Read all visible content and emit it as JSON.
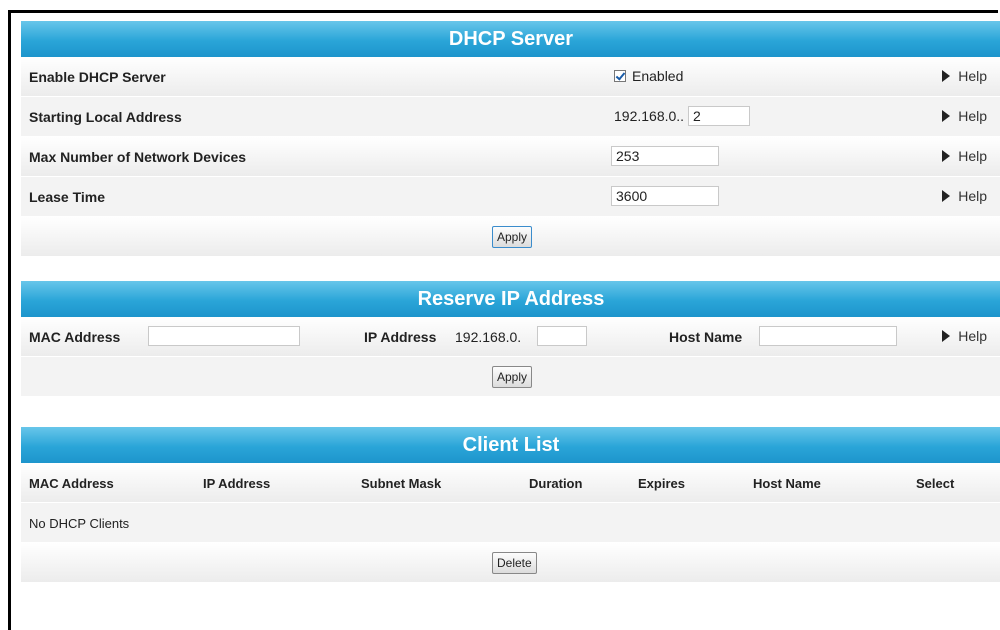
{
  "dhcp": {
    "title": "DHCP Server",
    "rows": {
      "enable": {
        "label": "Enable DHCP Server",
        "value": "Enabled",
        "checked": true
      },
      "start": {
        "label": "Starting Local Address",
        "prefix": "192.168.0..",
        "value": "2"
      },
      "max": {
        "label": "Max Number of Network Devices",
        "value": "253"
      },
      "lease": {
        "label": "Lease Time",
        "value": "3600"
      }
    },
    "help_label": "Help",
    "apply_label": "Apply"
  },
  "reserve": {
    "title": "Reserve IP Address",
    "mac_label": "MAC Address",
    "mac_value": "",
    "ip_label": "IP Address",
    "ip_prefix": "192.168.0.",
    "ip_value": "",
    "host_label": "Host Name",
    "host_value": "",
    "help_label": "Help",
    "apply_label": "Apply"
  },
  "clients": {
    "title": "Client List",
    "columns": [
      "MAC Address",
      "IP Address",
      "Subnet Mask",
      "Duration",
      "Expires",
      "Host Name",
      "Select"
    ],
    "empty_message": "No DHCP Clients",
    "delete_label": "Delete"
  }
}
